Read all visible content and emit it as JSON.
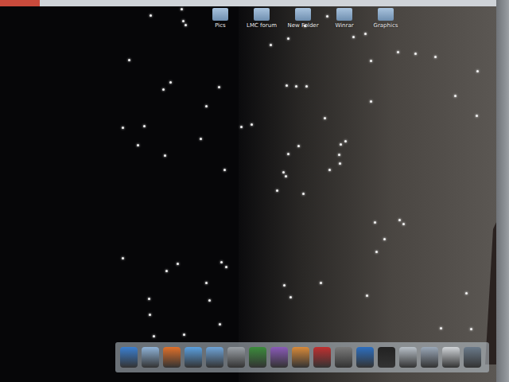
{
  "desktop_icons": [
    {
      "label": "Pics"
    },
    {
      "label": "LMC forum"
    },
    {
      "label": "New Folder"
    },
    {
      "label": "Winrar"
    },
    {
      "label": "Graphics"
    }
  ]
}
